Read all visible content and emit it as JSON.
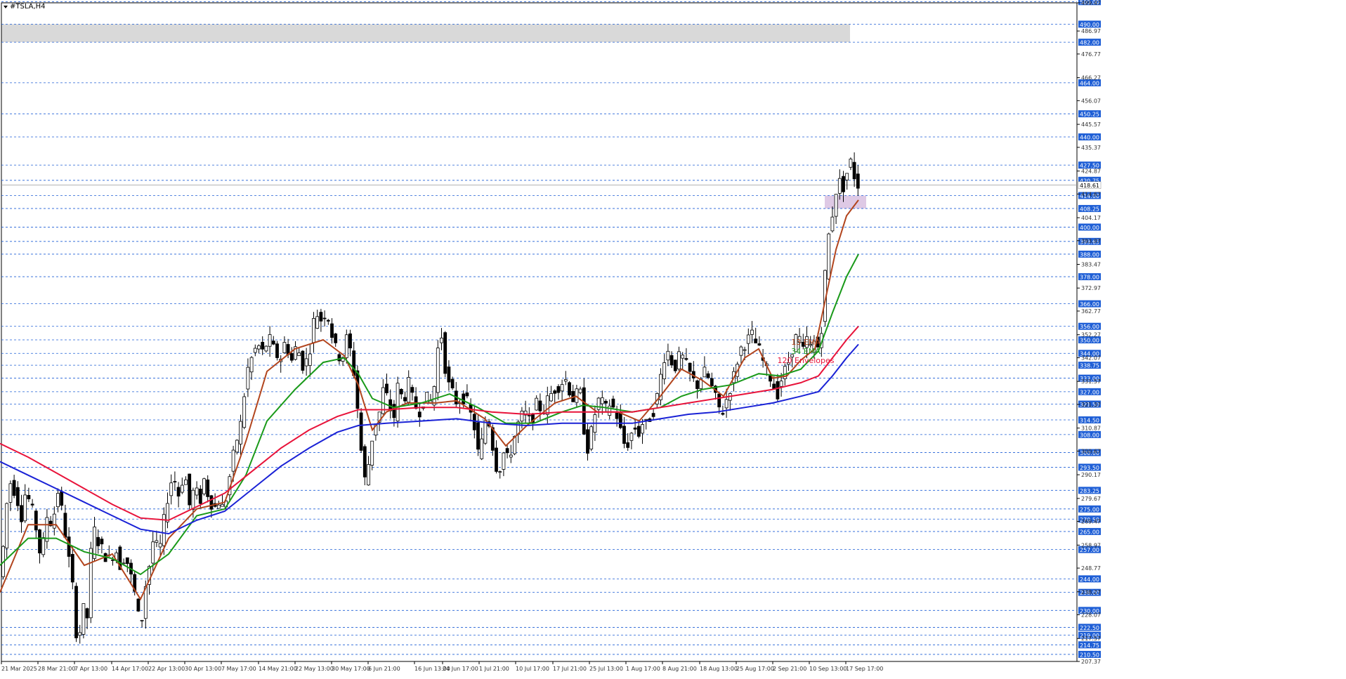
{
  "chart_data": {
    "type": "candlestick",
    "title": "#TSLA,H4",
    "y_range": [
      207.37,
      499.47
    ],
    "price_ticks": [
      "499.47",
      "486.97",
      "476.77",
      "466.27",
      "456.07",
      "445.57",
      "435.37",
      "424.87",
      "414.67",
      "404.17",
      "393.97",
      "383.47",
      "372.97",
      "362.77",
      "352.27",
      "342.07",
      "331.57",
      "321.37",
      "310.87",
      "300.67",
      "290.17",
      "279.67",
      "269.47",
      "258.97",
      "248.77",
      "238.27",
      "228.07",
      "217.57",
      "207.37"
    ],
    "levels": [
      "500.00",
      "490.00",
      "482.00",
      "464.00",
      "450.25",
      "440.00",
      "427.50",
      "420.75",
      "414.00",
      "408.25",
      "400.00",
      "393.65",
      "388.00",
      "378.00",
      "366.00",
      "356.00",
      "350.00",
      "344.00",
      "338.75",
      "333.00",
      "327.00",
      "321.50",
      "314.50",
      "308.00",
      "300.00",
      "293.50",
      "283.25",
      "275.00",
      "270.50",
      "265.00",
      "257.00",
      "244.00",
      "238.00",
      "230.00",
      "222.50",
      "219.00",
      "214.75",
      "210.50"
    ],
    "current_price": "418.61",
    "level_color": "#1f5fd6",
    "x_labels": [
      "21 Mar 2025",
      "28 Mar 21:00",
      "7 Apr 13:00",
      "14 Apr 17:00",
      "22 Apr 13:00",
      "30 Apr 13:00",
      "7 May 17:00",
      "14 May 21:00",
      "22 May 13:00",
      "30 May 17:00",
      "6 Jun 21:00",
      "16 Jun 13:00",
      "24 Jun 17:00",
      "1 Jul 21:00",
      "10 Jul 17:00",
      "17 Jul 21:00",
      "25 Jul 13:00",
      "1 Aug 17:00",
      "8 Aug 21:00",
      "18 Aug 13:00",
      "25 Aug 17:00",
      "2 Sep 21:00",
      "10 Sep 13:00",
      "17 Sep 17:00"
    ],
    "zones": [
      {
        "from": 482,
        "to": 490,
        "color": "#d9d9d9"
      },
      {
        "from": 408.25,
        "to": 414,
        "color": "#d8bfe0"
      }
    ],
    "path": [
      [
        0,
        248
      ],
      [
        4,
        258
      ],
      [
        8,
        275
      ],
      [
        14,
        287
      ],
      [
        22,
        282
      ],
      [
        30,
        272
      ],
      [
        36,
        283
      ],
      [
        44,
        276
      ],
      [
        52,
        265
      ],
      [
        58,
        252
      ],
      [
        66,
        272
      ],
      [
        74,
        268
      ],
      [
        82,
        283
      ],
      [
        90,
        270
      ],
      [
        96,
        255
      ],
      [
        102,
        245
      ],
      [
        106,
        222
      ],
      [
        112,
        218
      ],
      [
        118,
        232
      ],
      [
        122,
        215
      ],
      [
        126,
        245
      ],
      [
        132,
        267
      ],
      [
        140,
        260
      ],
      [
        148,
        255
      ],
      [
        156,
        252
      ],
      [
        164,
        258
      ],
      [
        170,
        250
      ],
      [
        178,
        255
      ],
      [
        184,
        247
      ],
      [
        190,
        240
      ],
      [
        196,
        228
      ],
      [
        200,
        222
      ],
      [
        206,
        240
      ],
      [
        212,
        250
      ],
      [
        218,
        262
      ],
      [
        226,
        255
      ],
      [
        232,
        268
      ],
      [
        240,
        284
      ],
      [
        246,
        290
      ],
      [
        254,
        281
      ],
      [
        262,
        292
      ],
      [
        270,
        275
      ],
      [
        276,
        285
      ],
      [
        284,
        278
      ],
      [
        290,
        288
      ],
      [
        296,
        281
      ],
      [
        304,
        275
      ],
      [
        312,
        279
      ],
      [
        318,
        274
      ],
      [
        324,
        285
      ],
      [
        330,
        296
      ],
      [
        336,
        305
      ],
      [
        344,
        315
      ],
      [
        350,
        335
      ],
      [
        358,
        342
      ],
      [
        366,
        348
      ],
      [
        374,
        344
      ],
      [
        382,
        351
      ],
      [
        390,
        345
      ],
      [
        398,
        341
      ],
      [
        406,
        350
      ],
      [
        414,
        340
      ],
      [
        420,
        346
      ],
      [
        426,
        344
      ],
      [
        432,
        337
      ],
      [
        440,
        345
      ],
      [
        446,
        358
      ],
      [
        452,
        362
      ],
      [
        458,
        358
      ],
      [
        464,
        364
      ],
      [
        470,
        355
      ],
      [
        478,
        345
      ],
      [
        486,
        341
      ],
      [
        494,
        352
      ],
      [
        500,
        342
      ],
      [
        506,
        330
      ],
      [
        512,
        305
      ],
      [
        516,
        295
      ],
      [
        520,
        285
      ],
      [
        526,
        300
      ],
      [
        532,
        312
      ],
      [
        540,
        318
      ],
      [
        546,
        330
      ],
      [
        552,
        322
      ],
      [
        560,
        315
      ],
      [
        566,
        330
      ],
      [
        574,
        322
      ],
      [
        580,
        332
      ],
      [
        588,
        322
      ],
      [
        596,
        318
      ],
      [
        604,
        325
      ],
      [
        612,
        322
      ],
      [
        618,
        330
      ],
      [
        624,
        350
      ],
      [
        628,
        352
      ],
      [
        632,
        340
      ],
      [
        638,
        330
      ],
      [
        644,
        326
      ],
      [
        650,
        322
      ],
      [
        656,
        324
      ],
      [
        662,
        325
      ],
      [
        668,
        318
      ],
      [
        674,
        313
      ],
      [
        680,
        300
      ],
      [
        686,
        305
      ],
      [
        692,
        318
      ],
      [
        698,
        310
      ],
      [
        704,
        295
      ],
      [
        710,
        292
      ],
      [
        716,
        300
      ],
      [
        722,
        297
      ],
      [
        728,
        302
      ],
      [
        734,
        310
      ],
      [
        740,
        315
      ],
      [
        746,
        318
      ],
      [
        752,
        314
      ],
      [
        758,
        316
      ],
      [
        764,
        322
      ],
      [
        772,
        318
      ],
      [
        780,
        324
      ],
      [
        788,
        328
      ],
      [
        796,
        330
      ],
      [
        804,
        333
      ],
      [
        812,
        326
      ],
      [
        818,
        322
      ],
      [
        824,
        331
      ],
      [
        830,
        312
      ],
      [
        836,
        302
      ],
      [
        842,
        310
      ],
      [
        848,
        320
      ],
      [
        854,
        325
      ],
      [
        860,
        318
      ],
      [
        866,
        322
      ],
      [
        872,
        320
      ],
      [
        878,
        316
      ],
      [
        884,
        308
      ],
      [
        890,
        302
      ],
      [
        896,
        306
      ],
      [
        902,
        312
      ],
      [
        908,
        308
      ],
      [
        914,
        313
      ],
      [
        920,
        312
      ],
      [
        926,
        317
      ],
      [
        932,
        320
      ],
      [
        938,
        330
      ],
      [
        944,
        342
      ],
      [
        950,
        345
      ],
      [
        956,
        340
      ],
      [
        962,
        338
      ],
      [
        968,
        344
      ],
      [
        974,
        340
      ],
      [
        980,
        336
      ],
      [
        986,
        332
      ],
      [
        992,
        330
      ],
      [
        998,
        334
      ],
      [
        1004,
        336
      ],
      [
        1010,
        331
      ],
      [
        1016,
        326
      ],
      [
        1022,
        320
      ],
      [
        1028,
        318
      ],
      [
        1034,
        324
      ],
      [
        1040,
        330
      ],
      [
        1046,
        336
      ],
      [
        1052,
        345
      ],
      [
        1058,
        348
      ],
      [
        1064,
        350
      ],
      [
        1070,
        352
      ],
      [
        1076,
        348
      ],
      [
        1082,
        344
      ],
      [
        1088,
        338
      ],
      [
        1094,
        335
      ],
      [
        1100,
        330
      ],
      [
        1106,
        326
      ],
      [
        1112,
        333
      ],
      [
        1118,
        337
      ],
      [
        1124,
        342
      ],
      [
        1130,
        350
      ],
      [
        1136,
        352
      ],
      [
        1142,
        344
      ],
      [
        1148,
        350
      ],
      [
        1154,
        346
      ],
      [
        1160,
        350
      ],
      [
        1166,
        345
      ],
      [
        1172,
        368
      ],
      [
        1176,
        390
      ],
      [
        1180,
        398
      ],
      [
        1184,
        405
      ],
      [
        1188,
        415
      ],
      [
        1194,
        420
      ],
      [
        1200,
        418
      ],
      [
        1206,
        425
      ],
      [
        1212,
        430
      ],
      [
        1216,
        422
      ],
      [
        1222,
        418
      ]
    ],
    "series": [
      {
        "name": "13 EMA",
        "color": "#b2451e",
        "values": [
          [
            0,
            238
          ],
          [
            40,
            268
          ],
          [
            80,
            268
          ],
          [
            120,
            250
          ],
          [
            160,
            255
          ],
          [
            200,
            235
          ],
          [
            240,
            262
          ],
          [
            280,
            275
          ],
          [
            320,
            278
          ],
          [
            350,
            305
          ],
          [
            380,
            336
          ],
          [
            420,
            346
          ],
          [
            460,
            350
          ],
          [
            490,
            343
          ],
          [
            510,
            330
          ],
          [
            530,
            310
          ],
          [
            550,
            318
          ],
          [
            580,
            322
          ],
          [
            620,
            322
          ],
          [
            650,
            323
          ],
          [
            690,
            315
          ],
          [
            720,
            303
          ],
          [
            750,
            312
          ],
          [
            790,
            322
          ],
          [
            820,
            325
          ],
          [
            850,
            318
          ],
          [
            880,
            318
          ],
          [
            910,
            314
          ],
          [
            940,
            325
          ],
          [
            970,
            337
          ],
          [
            1000,
            332
          ],
          [
            1030,
            325
          ],
          [
            1060,
            342
          ],
          [
            1080,
            346
          ],
          [
            1100,
            333
          ],
          [
            1120,
            334
          ],
          [
            1140,
            341
          ],
          [
            1160,
            346
          ],
          [
            1175,
            368
          ],
          [
            1190,
            390
          ],
          [
            1205,
            405
          ],
          [
            1222,
            412
          ]
        ]
      },
      {
        "name": "34 EMA",
        "color": "#1a9a1a",
        "values": [
          [
            0,
            250
          ],
          [
            40,
            262
          ],
          [
            80,
            262
          ],
          [
            120,
            256
          ],
          [
            160,
            253
          ],
          [
            200,
            246
          ],
          [
            240,
            255
          ],
          [
            280,
            272
          ],
          [
            320,
            275
          ],
          [
            350,
            290
          ],
          [
            380,
            314
          ],
          [
            420,
            328
          ],
          [
            460,
            340
          ],
          [
            490,
            342
          ],
          [
            510,
            335
          ],
          [
            530,
            324
          ],
          [
            560,
            320
          ],
          [
            600,
            322
          ],
          [
            640,
            326
          ],
          [
            680,
            320
          ],
          [
            720,
            313
          ],
          [
            760,
            313
          ],
          [
            800,
            318
          ],
          [
            830,
            321
          ],
          [
            860,
            320
          ],
          [
            900,
            318
          ],
          [
            940,
            320
          ],
          [
            970,
            325
          ],
          [
            1000,
            328
          ],
          [
            1040,
            330
          ],
          [
            1080,
            335
          ],
          [
            1110,
            334
          ],
          [
            1140,
            337
          ],
          [
            1165,
            345
          ],
          [
            1185,
            362
          ],
          [
            1205,
            378
          ],
          [
            1222,
            388
          ]
        ]
      },
      {
        "name": "120 Envelopes",
        "color": "#e8133a",
        "values": [
          [
            0,
            304
          ],
          [
            40,
            298
          ],
          [
            80,
            291
          ],
          [
            120,
            284
          ],
          [
            160,
            277
          ],
          [
            200,
            271
          ],
          [
            240,
            270
          ],
          [
            280,
            276
          ],
          [
            320,
            282
          ],
          [
            360,
            292
          ],
          [
            400,
            302
          ],
          [
            440,
            310
          ],
          [
            480,
            316
          ],
          [
            510,
            319
          ],
          [
            550,
            319
          ],
          [
            600,
            320
          ],
          [
            650,
            320
          ],
          [
            700,
            318
          ],
          [
            750,
            317
          ],
          [
            800,
            318
          ],
          [
            850,
            318
          ],
          [
            900,
            318
          ],
          [
            940,
            320
          ],
          [
            980,
            322
          ],
          [
            1020,
            324
          ],
          [
            1060,
            326
          ],
          [
            1100,
            328
          ],
          [
            1140,
            331
          ],
          [
            1165,
            334
          ],
          [
            1185,
            342
          ],
          [
            1205,
            350
          ],
          [
            1222,
            356
          ]
        ]
      },
      {
        "name": "120 Envelopes",
        "color": "#1a22d6",
        "values": [
          [
            0,
            296
          ],
          [
            40,
            290
          ],
          [
            80,
            284
          ],
          [
            120,
            278
          ],
          [
            160,
            272
          ],
          [
            200,
            266
          ],
          [
            240,
            264
          ],
          [
            280,
            270
          ],
          [
            320,
            274
          ],
          [
            360,
            284
          ],
          [
            400,
            294
          ],
          [
            440,
            302
          ],
          [
            480,
            309
          ],
          [
            510,
            312
          ],
          [
            550,
            313
          ],
          [
            600,
            314
          ],
          [
            650,
            315
          ],
          [
            700,
            313
          ],
          [
            750,
            312
          ],
          [
            800,
            313
          ],
          [
            850,
            313
          ],
          [
            900,
            313
          ],
          [
            940,
            315
          ],
          [
            980,
            317
          ],
          [
            1020,
            318
          ],
          [
            1060,
            320
          ],
          [
            1100,
            322
          ],
          [
            1140,
            325
          ],
          [
            1165,
            327
          ],
          [
            1185,
            334
          ],
          [
            1205,
            342
          ],
          [
            1222,
            348
          ]
        ]
      }
    ],
    "legend": [
      {
        "text": "13 EMA",
        "color": "#b2451e"
      },
      {
        "text": "34 EMA",
        "color": "#1a9a1a"
      },
      {
        "text": "120 Envelopes",
        "color": "#e8133a"
      }
    ]
  }
}
